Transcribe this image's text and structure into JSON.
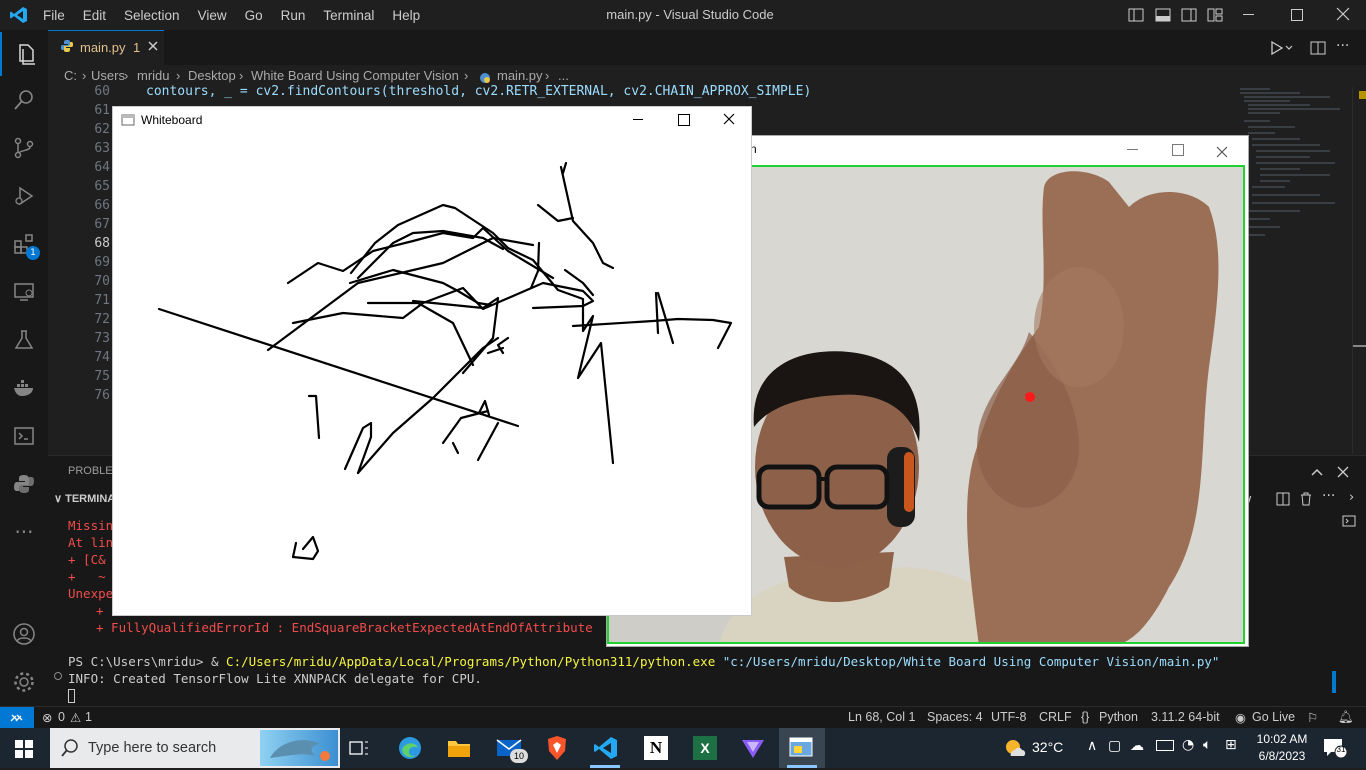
{
  "titlebar": {
    "menu": [
      "File",
      "Edit",
      "Selection",
      "View",
      "Go",
      "Run",
      "Terminal",
      "Help"
    ],
    "title": "main.py - Visual Studio Code"
  },
  "tab": {
    "label": "main.py",
    "badge": "1"
  },
  "breadcrumb": [
    "C:",
    "Users",
    "mridu",
    "Desktop",
    "White Board Using Computer Vision",
    "main.py",
    "..."
  ],
  "editor": {
    "line_numbers": [
      "60",
      "61",
      "62",
      "63",
      "64",
      "65",
      "66",
      "67",
      "68",
      "69",
      "70",
      "71",
      "72",
      "73",
      "74",
      "75",
      "76"
    ],
    "current_line": "68",
    "visible_code": {
      "line60": "contours, _ = cv2.findContours(threshold, cv2.RETR_EXTERNAL, cv2.CHAIN_APPROX_SIMPLE)"
    }
  },
  "panel": {
    "tab_problems": "PROBLEMS",
    "tab_terminal": "TERMINAL",
    "error_lines": [
      "Missing",
      "At line",
      "+ [C& C",
      "+   ~",
      "Unexpec"
    ],
    "error_detail_1": "+ ...",
    "error_detail_2": "+ FullyQualifiedErrorId : EndSquareBracketExpectedAtEndOfAttribute",
    "prompt": "PS C:\\Users\\mridu> & ",
    "python_path": "C:/Users/mridu/AppData/Local/Programs/Python/Python311/python.exe",
    "script_arg": "\"c:/Users/mridu/Desktop/White Board Using Computer Vision/main.py\"",
    "info": "INFO: Created TensorFlow Lite XNNPACK delegate for CPU."
  },
  "status": {
    "errors": "0",
    "warnings": "1",
    "position": "Ln 68, Col 1",
    "spaces": "Spaces: 4",
    "encoding": "UTF-8",
    "eol": "CRLF",
    "language": "Python",
    "interpreter": "3.11.2 64-bit",
    "golive": "Go Live"
  },
  "whiteboard": {
    "title": "Whiteboard"
  },
  "camera": {
    "title_fragment": "n"
  },
  "taskbar": {
    "search_placeholder": "Type here to search",
    "mail_badge": "10",
    "weather": "32°C",
    "time": "10:02 AM",
    "date": "6/8/2023",
    "notifications": "31"
  },
  "colors": {
    "accent": "#0078d4",
    "status_remote": "#0078d4",
    "error": "#f14c4c",
    "camera_border": "#21d031"
  }
}
